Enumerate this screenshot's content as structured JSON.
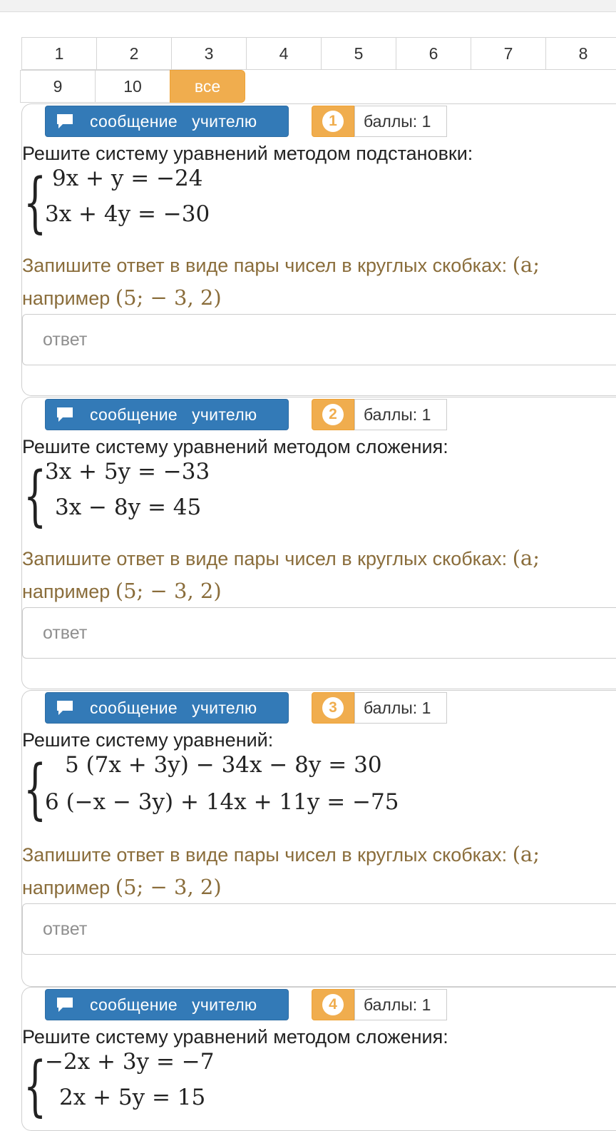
{
  "pagination": {
    "row1": [
      "1",
      "2",
      "3",
      "4",
      "5",
      "6",
      "7",
      "8"
    ],
    "row2": [
      "9",
      "10",
      "все"
    ],
    "active": "все"
  },
  "message_button_label": "сообщение   учителю",
  "instruction_text": "Запишите ответ в виде пары чисел в круглых скобках: ",
  "instruction_math": "(a;",
  "example_text": "например ",
  "example_math": "(5;  − 3, 2)",
  "answer_placeholder": "ответ",
  "colors": {
    "primary": "#337ab7",
    "warning": "#f0ad4e",
    "instruction": "#8a6d3b"
  },
  "questions": [
    {
      "number": "1",
      "score": "баллы: 1",
      "prompt": "Решите систему уравнений методом подстановки:",
      "equations": [
        "9x + y = −24",
        "3x + 4y = −30"
      ]
    },
    {
      "number": "2",
      "score": "баллы: 1",
      "prompt": "Решите систему уравнений методом сложения:",
      "equations": [
        "3x + 5y = −33",
        "3x − 8y = 45"
      ]
    },
    {
      "number": "3",
      "score": "баллы: 1",
      "prompt": "Решите систему уравнений:",
      "equations": [
        "5 (7x + 3y) − 34x − 8y = 30",
        "6 (−x − 3y) + 14x + 11y = −75"
      ]
    },
    {
      "number": "4",
      "score": "баллы: 1",
      "prompt": "Решите систему уравнений методом сложения:",
      "equations": [
        "−2x + 3y = −7",
        "2x + 5y = 15"
      ]
    }
  ]
}
